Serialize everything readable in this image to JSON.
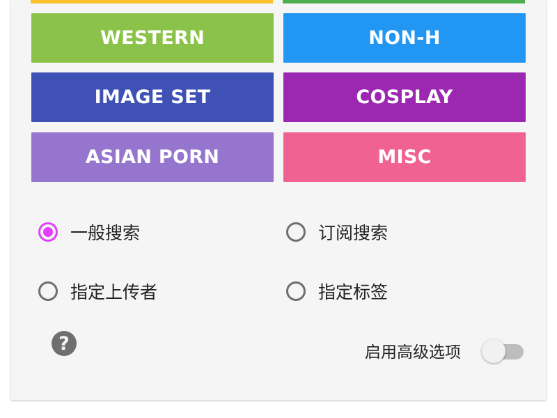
{
  "colors": {
    "yellow_strip": "#fbc02d",
    "green_strip": "#4caf50",
    "western": "#8bc34a",
    "non_h": "#2196f3",
    "image_set": "#3f51b5",
    "cosplay": "#9c27b0",
    "asian_porn": "#9575cd",
    "misc": "#f06292",
    "radio_checked": "#e040fb"
  },
  "categories": {
    "western": "WESTERN",
    "non_h": "NON-H",
    "image_set": "IMAGE SET",
    "cosplay": "COSPLAY",
    "asian_porn": "ASIAN PORN",
    "misc": "MISC"
  },
  "search_mode": {
    "selected": "normal",
    "normal": "一般搜索",
    "subscription": "订阅搜索",
    "uploader": "指定上传者",
    "tag": "指定标签"
  },
  "help": {
    "icon": "help-icon",
    "glyph": "?"
  },
  "advanced": {
    "label": "启用高级选项",
    "enabled": false
  }
}
